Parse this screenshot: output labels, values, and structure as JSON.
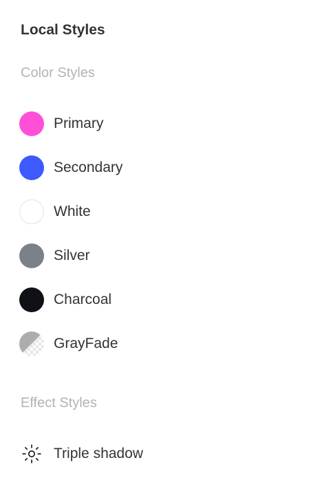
{
  "panel": {
    "title": "Local Styles"
  },
  "color_styles": {
    "header": "Color Styles",
    "items": [
      {
        "label": "Primary",
        "color": "#ff4fd8",
        "swatch": "solid"
      },
      {
        "label": "Secondary",
        "color": "#3d5afe",
        "swatch": "solid"
      },
      {
        "label": "White",
        "color": "#ffffff",
        "swatch": "solid-bordered"
      },
      {
        "label": "Silver",
        "color": "#7c8089",
        "swatch": "solid"
      },
      {
        "label": "Charcoal",
        "color": "#0f1116",
        "swatch": "solid"
      },
      {
        "label": "GrayFade",
        "color": "#aaaaaa",
        "swatch": "gradient-transparent"
      }
    ]
  },
  "effect_styles": {
    "header": "Effect Styles",
    "items": [
      {
        "label": "Triple shadow",
        "icon": "sun-effect-icon"
      }
    ]
  }
}
